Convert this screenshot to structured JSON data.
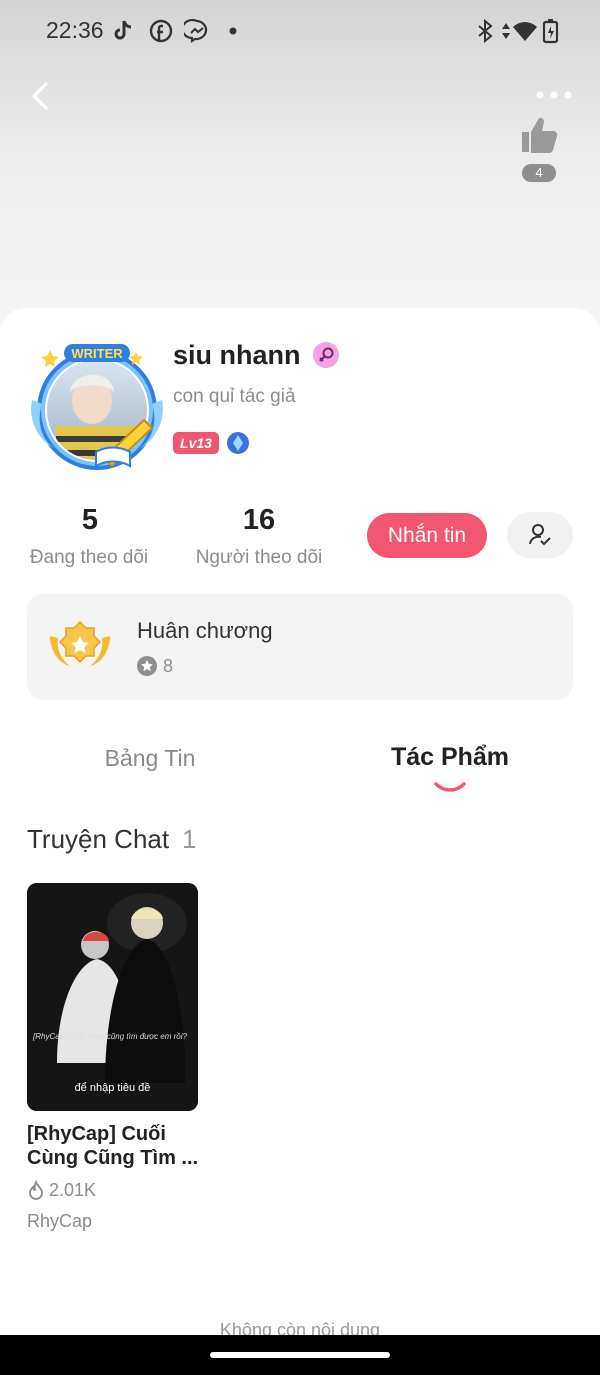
{
  "status_bar": {
    "time": "22:36"
  },
  "header": {
    "like_count": "4"
  },
  "profile": {
    "name": "siu nhann",
    "bio": "con quỉ tác giả",
    "level": "Lv13",
    "avatar_badge": "WRITER"
  },
  "stats": {
    "following": {
      "value": "5",
      "label": "Đang theo dõi"
    },
    "followers": {
      "value": "16",
      "label": "Người theo dõi"
    }
  },
  "actions": {
    "message_label": "Nhắn tin"
  },
  "medal": {
    "title": "Huân chương",
    "count": "8"
  },
  "tabs": [
    {
      "label": "Bảng Tin",
      "active": false
    },
    {
      "label": "Tác Phẩm",
      "active": true
    }
  ],
  "section": {
    "title": "Truyện Chat",
    "count": "1"
  },
  "stories": [
    {
      "cover_overlay": "[RhyCap] Cuối cùng cũng tìm được em rồi?",
      "cover_caption": "để nhập tiêu đề",
      "title": "[RhyCap] Cuối Cùng Cũng Tìm ...",
      "views": "2.01K",
      "tag": "RhyCap"
    }
  ],
  "footer": {
    "end_text": "Không còn nội dung"
  },
  "colors": {
    "accent": "#f2576f",
    "medal_gold": "#f5b82e",
    "level_badge": "#f0566f"
  }
}
